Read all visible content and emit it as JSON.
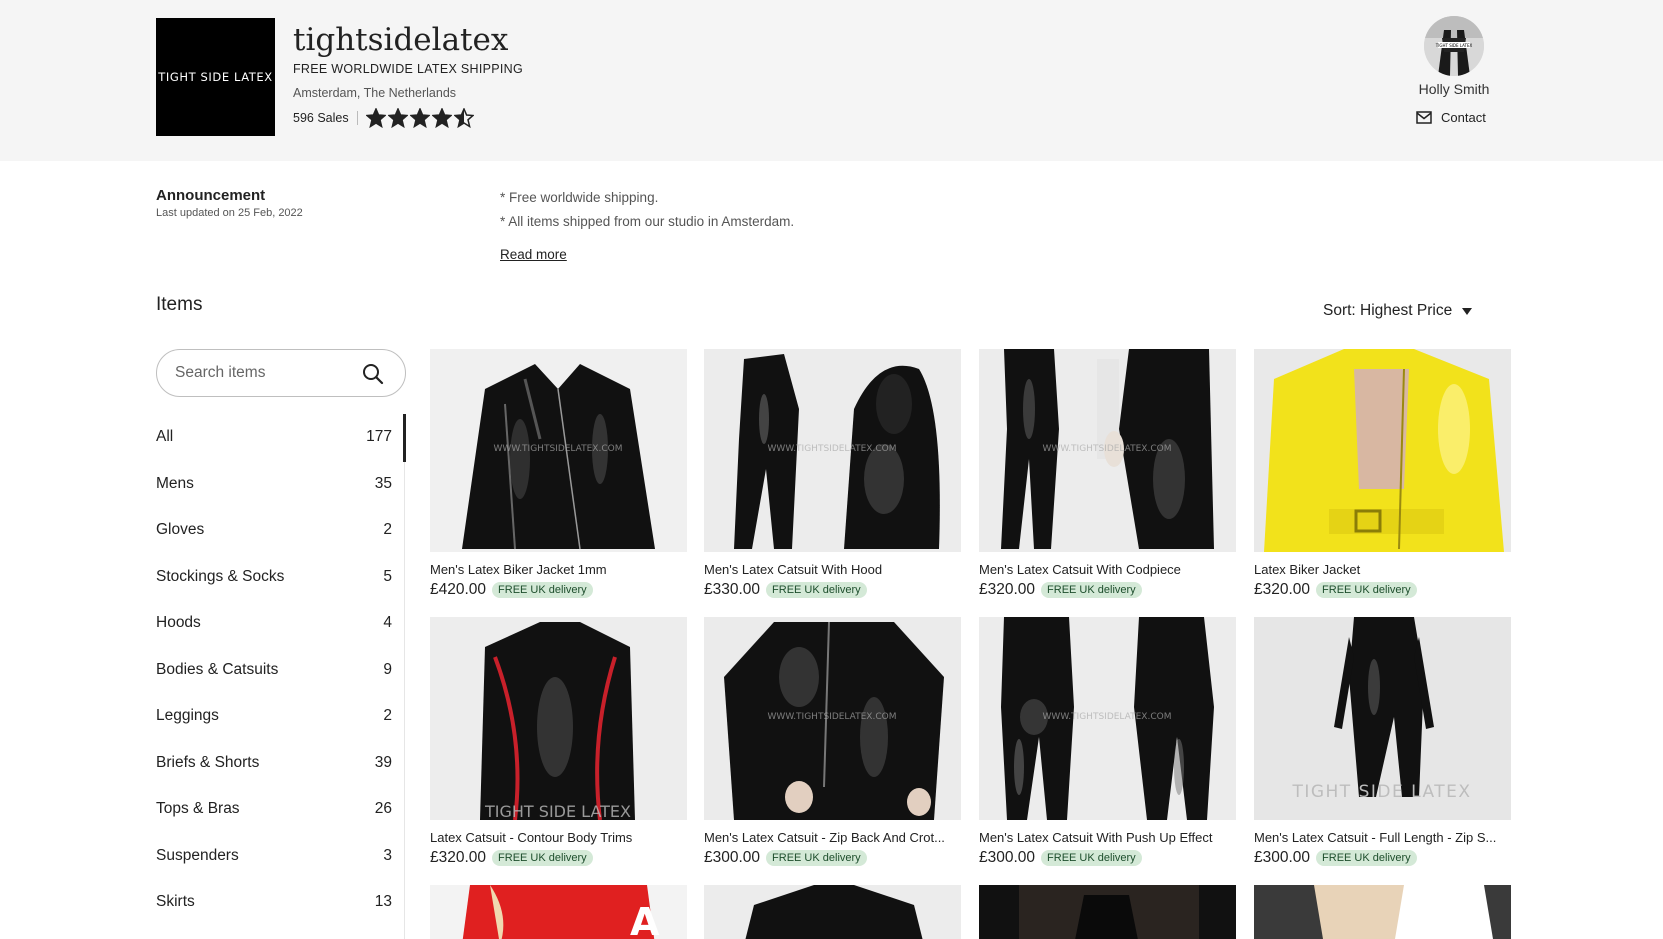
{
  "shop": {
    "logo_text": "TIGHT SIDE LATEX",
    "name": "tightsidelatex",
    "tagline": "FREE WORLDWIDE LATEX SHIPPING",
    "location": "Amsterdam, The Netherlands",
    "sales": "596 Sales",
    "rating": 4.5
  },
  "owner": {
    "name": "Holly Smith",
    "contact_label": "Contact",
    "avatar_icon": "owner-photo"
  },
  "announcement": {
    "title": "Announcement",
    "updated": "Last updated on 25 Feb, 2022",
    "line1": "* Free worldwide shipping.",
    "line2": "* All items shipped from our studio in Amsterdam.",
    "read_more": "Read more"
  },
  "items": {
    "title": "Items",
    "sort_label": "Sort: Highest Price",
    "search_placeholder": "Search items",
    "search_icon": "magnifier-icon"
  },
  "categories": [
    {
      "label": "All",
      "count": "177",
      "active": true
    },
    {
      "label": "Mens",
      "count": "35"
    },
    {
      "label": "Gloves",
      "count": "2"
    },
    {
      "label": "Stockings & Socks",
      "count": "5"
    },
    {
      "label": "Hoods",
      "count": "4"
    },
    {
      "label": "Bodies & Catsuits",
      "count": "9"
    },
    {
      "label": "Leggings",
      "count": "2"
    },
    {
      "label": "Briefs & Shorts",
      "count": "39"
    },
    {
      "label": "Tops & Bras",
      "count": "26"
    },
    {
      "label": "Suspenders",
      "count": "3"
    },
    {
      "label": "Skirts",
      "count": "13"
    }
  ],
  "products": [
    {
      "title": "Men's Latex Biker Jacket 1mm",
      "price": "£420.00",
      "badge": "FREE UK delivery",
      "image": "black latex jacket",
      "color": "#111111"
    },
    {
      "title": "Men's Latex Catsuit With Hood",
      "price": "£330.00",
      "badge": "FREE UK delivery",
      "image": "black hooded catsuit",
      "color": "#111111"
    },
    {
      "title": "Men's Latex Catsuit With Codpiece",
      "price": "£320.00",
      "badge": "FREE UK delivery",
      "image": "black catsuit codpiece",
      "color": "#111111"
    },
    {
      "title": "Latex Biker Jacket",
      "price": "£320.00",
      "badge": "FREE UK delivery",
      "image": "yellow latex jacket",
      "color": "#f2e21b"
    },
    {
      "title": "Latex Catsuit - Contour Body Trims",
      "price": "£320.00",
      "badge": "FREE UK delivery",
      "image": "black catsuit red trims",
      "color": "#111111",
      "trim": "#c8202a"
    },
    {
      "title": "Men's Latex Catsuit - Zip Back And Crot...",
      "price": "£300.00",
      "badge": "FREE UK delivery",
      "image": "black catsuit zip back",
      "color": "#111111"
    },
    {
      "title": "Men's Latex Catsuit With Push Up Effect",
      "price": "£300.00",
      "badge": "FREE UK delivery",
      "image": "black catsuit push up",
      "color": "#111111"
    },
    {
      "title": "Men's Latex Catsuit - Full Length - Zip S...",
      "price": "£300.00",
      "badge": "FREE UK delivery",
      "image": "black full length catsuit",
      "color": "#111111"
    }
  ],
  "watermarks": {
    "url": "WWW.TIGHTSIDELATEX.COM",
    "brand": "TIGHT SIDE LATEX"
  },
  "colors": {
    "badge_bg": "#d4e9d7",
    "badge_text": "#1d4e2c",
    "header_bg": "#f5f5f5"
  }
}
